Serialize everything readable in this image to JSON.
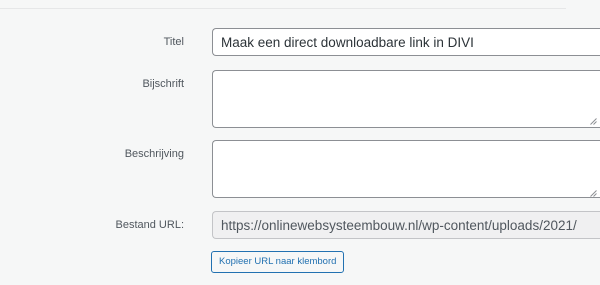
{
  "attachment_details": {
    "title": {
      "label": "Titel",
      "value": "Maak een direct downloadbare link in DIVI"
    },
    "caption": {
      "label": "Bijschrift",
      "value": ""
    },
    "description": {
      "label": "Beschrijving",
      "value": ""
    },
    "file_url": {
      "label": "Bestand URL:",
      "value": "https://onlinewebsysteembouw.nl/wp-content/uploads/2021/",
      "copy_button_label": "Kopieer URL naar klembord"
    }
  },
  "icons": {
    "textarea_resize": "resize-handle-icon"
  },
  "colors": {
    "panel_background": "#f6f7f7",
    "input_border": "#8c8f94",
    "readonly_background": "#f0f0f1",
    "accent": "#2271b1",
    "label_text": "#50575e"
  }
}
